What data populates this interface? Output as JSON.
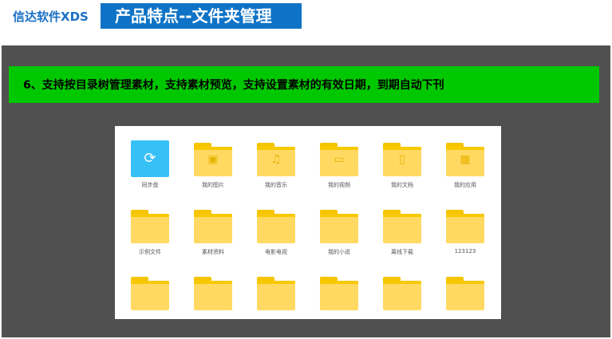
{
  "header": {
    "brand": "信达软件XDS",
    "title": "产品特点--文件夹管理"
  },
  "banner": {
    "text": "6、支持按目录树管理素材，支持素材预览，支持设置素材的有效日期，到期自动下刊"
  },
  "colors": {
    "brand_blue": "#1a6fc4",
    "title_bg": "#0e73c6",
    "banner_green": "#00c800",
    "stage_gray": "#505050",
    "folder_yellow": "#ffd962",
    "sync_blue": "#37c0f6"
  },
  "folders": [
    {
      "label": "同步盘",
      "icon": "sync-icon"
    },
    {
      "label": "我的图片",
      "icon": "image-icon"
    },
    {
      "label": "我的音乐",
      "icon": "music-icon"
    },
    {
      "label": "我的视频",
      "icon": "video-icon"
    },
    {
      "label": "我的文档",
      "icon": "document-icon"
    },
    {
      "label": "我的应用",
      "icon": "apps-icon"
    },
    {
      "label": "示例文件",
      "icon": "folder-icon"
    },
    {
      "label": "素材资料",
      "icon": "folder-icon"
    },
    {
      "label": "电影电视",
      "icon": "folder-icon"
    },
    {
      "label": "我的小说",
      "icon": "folder-icon"
    },
    {
      "label": "离线下载",
      "icon": "folder-icon"
    },
    {
      "label": "123123",
      "icon": "folder-icon"
    },
    {
      "label": "",
      "icon": "folder-icon"
    },
    {
      "label": "",
      "icon": "folder-icon"
    },
    {
      "label": "",
      "icon": "folder-icon"
    },
    {
      "label": "",
      "icon": "folder-icon"
    },
    {
      "label": "",
      "icon": "folder-icon"
    },
    {
      "label": "",
      "icon": "folder-icon"
    }
  ]
}
